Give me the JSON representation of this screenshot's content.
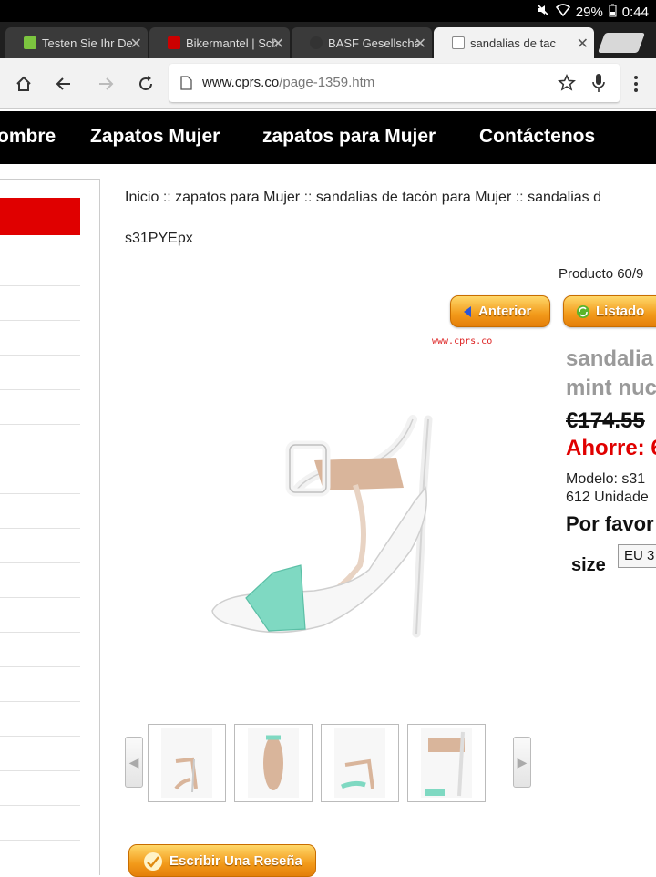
{
  "status": {
    "battery": "29%",
    "time": "0:44"
  },
  "tabs": [
    {
      "title": "Testen Sie Ihr De",
      "favicon": "green-check-icon",
      "color": "#7cc53f"
    },
    {
      "title": "Bikermantel | Sch",
      "favicon": "hm-logo-icon",
      "color": "#cc0000"
    },
    {
      "title": "BASF Gesellschaft",
      "favicon": "tripadvisor-icon",
      "color": "#333333"
    },
    {
      "title": "sandalias de tac",
      "favicon": "page-icon",
      "color": "#888888"
    }
  ],
  "toolbar": {
    "url_host": "www.cprs.co",
    "url_path": "/page-1359.htm"
  },
  "nav": {
    "items": [
      "ombre",
      "Zapatos Mujer",
      "zapatos para Mujer",
      "Contáctenos"
    ]
  },
  "breadcrumb": {
    "items": [
      "Inicio",
      "zapatos para Mujer",
      "sandalias de tacón para Mujer",
      "sandalias d"
    ],
    "separator": "::"
  },
  "product": {
    "code": "s31PYEpx",
    "counter": "Producto 60/9",
    "prev_label": "Anterior",
    "list_label": "Listado",
    "watermark": "www.cprs.co",
    "name_line1": "sandalia",
    "name_line2": "mint nuc",
    "old_price": "€174.55",
    "saving": "Ahorre: 6",
    "model_line1": "Modelo: s31",
    "model_line2": "612 Unidade",
    "favor": "Por favor",
    "size_label": "size",
    "size_value": "EU 3"
  },
  "review": {
    "label": "Escribir Una Reseña"
  },
  "colors": {
    "accent_red": "#e00000",
    "button_orange": "#f29a1a"
  }
}
